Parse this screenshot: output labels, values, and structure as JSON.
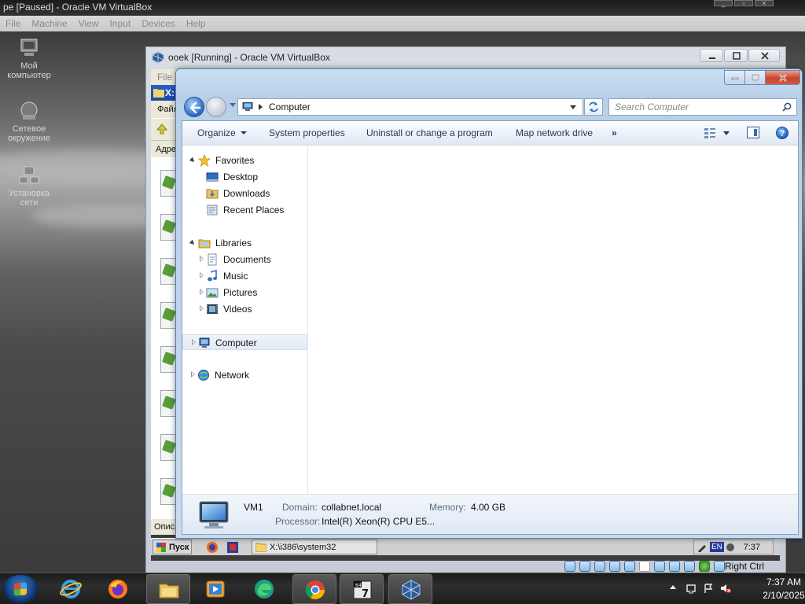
{
  "outer_vm": {
    "title": "pe [Paused] - Oracle VM VirtualBox",
    "menu": [
      "File",
      "Machine",
      "View",
      "Input",
      "Devices",
      "Help"
    ],
    "desktop_icons": [
      {
        "label": "Мой компьютер",
        "icon": "my-computer-icon"
      },
      {
        "label": "Сетевое окружение",
        "icon": "network-places-icon"
      },
      {
        "label": "Установка сети",
        "icon": "network-setup-icon"
      }
    ]
  },
  "vm_window": {
    "title": "ooek [Running] - Oracle VM VirtualBox",
    "inner": {
      "menu_first": "File",
      "window_title": "X:",
      "file_menu": "Файл",
      "address_label": "Адре",
      "description_label": "Описа",
      "start_button": "Пуск",
      "task_folder": "X:\\i386\\system32",
      "tray_lang": "EN",
      "tray_time": "7:37"
    },
    "status_host_key": "Right Ctrl"
  },
  "explorer": {
    "address": {
      "location": "Computer",
      "icon": "computer-icon"
    },
    "search": {
      "placeholder": "Search Computer"
    },
    "commands": [
      "Organize",
      "System properties",
      "Uninstall or change a program",
      "Map network drive",
      "»"
    ],
    "nav": {
      "favorites": {
        "label": "Favorites",
        "items": [
          "Desktop",
          "Downloads",
          "Recent Places"
        ]
      },
      "libraries": {
        "label": "Libraries",
        "items": [
          "Documents",
          "Music",
          "Pictures",
          "Videos"
        ]
      },
      "computer": "Computer",
      "network": "Network"
    },
    "details": {
      "name": "VM1",
      "domain_label": "Domain:",
      "domain": "collabnet.local",
      "memory_label": "Memory:",
      "memory": "4.00 GB",
      "processor_label": "Processor:",
      "processor": "Intel(R) Xeon(R) CPU E5..."
    }
  },
  "taskbar": {
    "apps": [
      "internet-explorer-icon",
      "firefox-icon",
      "file-explorer-icon",
      "media-player-icon",
      "edge-icon",
      "chrome-icon",
      "7zip-icon",
      "virtualbox-icon"
    ],
    "time": "7:37 AM",
    "date": "2/10/2025"
  },
  "colors": {
    "accent": "#2f6fc2",
    "taskbar": "#1c1c1c",
    "close": "#c7432c"
  }
}
